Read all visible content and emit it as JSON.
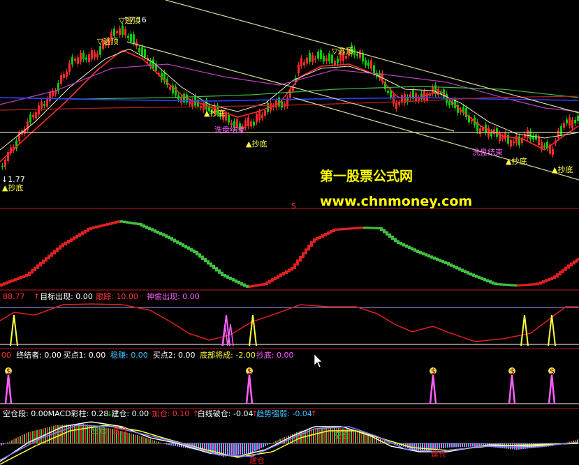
{
  "watermark": {
    "line1": "第一股票公式网",
    "line2": "www.chnmoney.com"
  },
  "colors": {
    "up": "#ff2a2a",
    "down": "#00d000",
    "accent_yellow": "#ffff40",
    "pink": "#ff60ff",
    "cyan": "#40c0ff",
    "white": "#ffffff",
    "green": "#40c040",
    "red": "#e02020"
  },
  "chart_data": [
    {
      "type": "candlestick",
      "name": "main",
      "price_labels": {
        "high": "7.16",
        "low": "1.77"
      },
      "annotations": [
        "逃顶",
        "逃顶",
        "逃顶",
        "抄底",
        "抄底",
        "抄底",
        "抄底",
        "抄底",
        "洗盘结束",
        "洗盘结束"
      ],
      "marker": "S"
    },
    {
      "type": "line",
      "name": "panel2"
    },
    {
      "type": "line",
      "name": "panel3",
      "header": [
        {
          "text": "88.77",
          "color": "#ff3030"
        },
        {
          "text": "↑",
          "color": "#ff3030"
        },
        {
          "text": "目标出现: 0.00",
          "color": "#ffffff"
        },
        {
          "text": "跟踪: 10.00",
          "color": "#ff3030"
        },
        {
          "text": "神偷出现: 0.00",
          "color": "#ff60ff"
        }
      ]
    },
    {
      "type": "bar",
      "name": "panel4",
      "header": [
        {
          "text": "00",
          "color": "#ff3030"
        },
        {
          "text": "终结者: 0.00",
          "color": "#ffffff"
        },
        {
          "text": "买点1: 0.00",
          "color": "#ffffff"
        },
        {
          "text": "稳赚: 0.00",
          "color": "#40c0ff"
        },
        {
          "text": "买点2: 0.00",
          "color": "#ffffff"
        },
        {
          "text": "底部将成: -2.00",
          "color": "#ffff40"
        },
        {
          "text": "抄底: 0.00",
          "color": "#ff60ff"
        }
      ],
      "marker": "$"
    },
    {
      "type": "bar",
      "name": "macd",
      "header": [
        {
          "text": "空仓段: 0.00",
          "color": "#ffffff"
        },
        {
          "text": "MACD彩柱: 0.28",
          "color": "#ffffff"
        },
        {
          "text": "↓",
          "color": "#00d000"
        },
        {
          "text": "建仓: 0.00",
          "color": "#ffffff"
        },
        {
          "text": "加仓: 0.10",
          "color": "#ff3030"
        },
        {
          "text": "↑",
          "color": "#ff3030"
        },
        {
          "text": "白线破仓: -0.04",
          "color": "#ffffff"
        },
        {
          "text": "↑",
          "color": "#ff3030"
        },
        {
          "text": "趋势强弱: -0.04",
          "color": "#40c0ff"
        },
        {
          "text": "↑",
          "color": "#ff3030"
        }
      ],
      "annotations": [
        "空仓",
        "建仓",
        "空仓",
        "建仓",
        "建仓"
      ]
    }
  ]
}
